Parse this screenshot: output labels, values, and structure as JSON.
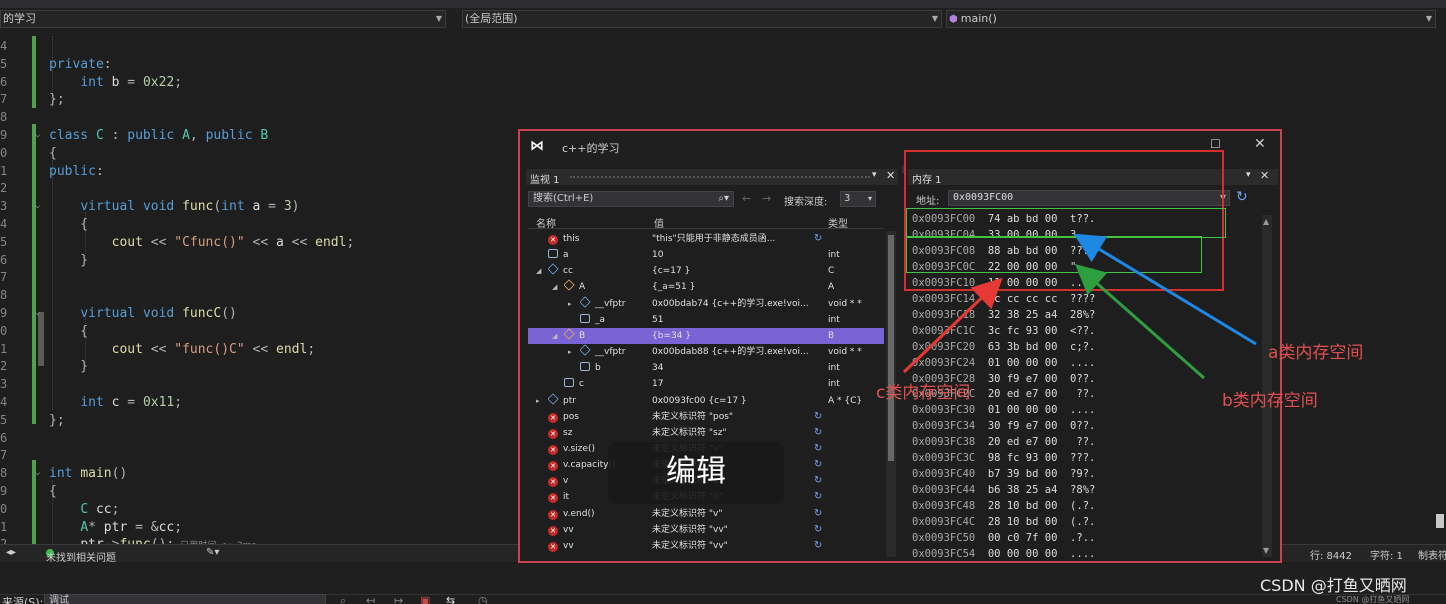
{
  "nav": {
    "project": "的学习",
    "scope": "(全局范围)",
    "member": "main()"
  },
  "code": {
    "lines": [
      {
        "n": "4",
        "t": ""
      },
      {
        "n": "5",
        "t": "private:"
      },
      {
        "n": "6",
        "t": "    int b = 0x22;"
      },
      {
        "n": "7",
        "t": "};"
      },
      {
        "n": "8",
        "t": ""
      },
      {
        "n": "9",
        "t": "class C : public A, public B"
      },
      {
        "n": "0",
        "t": "{"
      },
      {
        "n": "1",
        "t": "public:"
      },
      {
        "n": "2",
        "t": ""
      },
      {
        "n": "3",
        "t": "    virtual void func(int a = 3)"
      },
      {
        "n": "4",
        "t": "    {"
      },
      {
        "n": "5",
        "t": "        cout << \"Cfunc()\" << a << endl;"
      },
      {
        "n": "6",
        "t": "    }"
      },
      {
        "n": "7",
        "t": ""
      },
      {
        "n": "8",
        "t": ""
      },
      {
        "n": "9",
        "t": "    virtual void funcC()"
      },
      {
        "n": "0",
        "t": "    {"
      },
      {
        "n": "1",
        "t": "        cout << \"func()C\" << endl;"
      },
      {
        "n": "2",
        "t": "    }"
      },
      {
        "n": "3",
        "t": ""
      },
      {
        "n": "4",
        "t": "    int c = 0x11;"
      },
      {
        "n": "5",
        "t": "};"
      },
      {
        "n": "6",
        "t": ""
      },
      {
        "n": "7",
        "t": ""
      },
      {
        "n": "8",
        "t": "int main()"
      },
      {
        "n": "9",
        "t": "{"
      },
      {
        "n": "0",
        "t": "    C cc;"
      },
      {
        "n": "1",
        "t": "    A* ptr = &cc;"
      },
      {
        "n": "2",
        "t": "    ptr->func();"
      }
    ],
    "timing": "已用时间 <= 2ms"
  },
  "status": {
    "issues": "未找到相关问题",
    "line": "行: 8442",
    "char": "字符: 1",
    "mode": "制表符"
  },
  "bottom": {
    "source_label": "来源(S):",
    "source_value": "调试",
    "watermark": "CSDN @打鱼又晒网",
    "watermark2": "CSDN @打鱼又晒网"
  },
  "debug_window": {
    "title": "c++的学习",
    "watch": {
      "tab": "监视 1",
      "search_placeholder": "搜索(Ctrl+E)",
      "depth_label": "搜索深度:",
      "depth_value": "3",
      "headers": {
        "name": "名称",
        "value": "值",
        "type": "类型"
      },
      "rows": [
        {
          "name": "this",
          "value": "\"this\"只能用于非静态成员函...",
          "type": "",
          "icon": "error"
        },
        {
          "name": "a",
          "value": "10",
          "type": "int",
          "icon": "field"
        },
        {
          "name": "cc",
          "value": "{c=17 }",
          "type": "C",
          "icon": "cube"
        },
        {
          "name": "A",
          "value": "{_a=51 }",
          "type": "A",
          "icon": "base"
        },
        {
          "name": "__vfptr",
          "value": "0x00bdab74 {c++的学习.exe!voi...",
          "type": "void * *",
          "icon": "cube"
        },
        {
          "name": "_a",
          "value": "51",
          "type": "int",
          "icon": "field"
        },
        {
          "name": "B",
          "value": "{b=34 }",
          "type": "B",
          "icon": "base"
        },
        {
          "name": "__vfptr",
          "value": "0x00bdab88 {c++的学习.exe!voi...",
          "type": "void * *",
          "icon": "cube"
        },
        {
          "name": "b",
          "value": "34",
          "type": "int",
          "icon": "field"
        },
        {
          "name": "c",
          "value": "17",
          "type": "int",
          "icon": "field"
        },
        {
          "name": "ptr",
          "value": "0x0093fc00 {c=17 }",
          "type": "A * {C}",
          "icon": "cube"
        },
        {
          "name": "pos",
          "value": "未定义标识符 \"pos\"",
          "type": "",
          "icon": "error"
        },
        {
          "name": "sz",
          "value": "未定义标识符 \"sz\"",
          "type": "",
          "icon": "error"
        },
        {
          "name": "v.size()",
          "value": "未定义标识符 \"v\"",
          "type": "",
          "icon": "error"
        },
        {
          "name": "v.capacity()",
          "value": "未定义标识符 \"v\"",
          "type": "",
          "icon": "error"
        },
        {
          "name": "v",
          "value": "未定义标识符 \"v\"",
          "type": "",
          "icon": "error"
        },
        {
          "name": "it",
          "value": "未定义标识符 \"it\"",
          "type": "",
          "icon": "error"
        },
        {
          "name": "v.end()",
          "value": "未定义标识符 \"v\"",
          "type": "",
          "icon": "error"
        },
        {
          "name": "vv",
          "value": "未定义标识符 \"vv\"",
          "type": "",
          "icon": "error"
        },
        {
          "name": "vv",
          "value": "未定义标识符 \"vv\"",
          "type": "",
          "icon": "error"
        }
      ]
    },
    "memory": {
      "tab": "内存 1",
      "address_label": "地址:",
      "address_value": "0x0093FC00",
      "lines": [
        {
          "addr": "0x0093FC00",
          "bytes": "74 ab bd 00",
          "chars": "t??."
        },
        {
          "addr": "0x0093FC04",
          "bytes": "33 00 00 00",
          "chars": "3..."
        },
        {
          "addr": "0x0093FC08",
          "bytes": "88 ab bd 00",
          "chars": "???."
        },
        {
          "addr": "0x0093FC0C",
          "bytes": "22 00 00 00",
          "chars": "\"..."
        },
        {
          "addr": "0x0093FC10",
          "bytes": "11 00 00 00",
          "chars": "...."
        },
        {
          "addr": "0x0093FC14",
          "bytes": "cc cc cc cc",
          "chars": "????"
        },
        {
          "addr": "0x0093FC18",
          "bytes": "32 38 25 a4",
          "chars": "28%?"
        },
        {
          "addr": "0x0093FC1C",
          "bytes": "3c fc 93 00",
          "chars": "<??."
        },
        {
          "addr": "0x0093FC20",
          "bytes": "63 3b bd 00",
          "chars": "c;?."
        },
        {
          "addr": "0x0093FC24",
          "bytes": "01 00 00 00",
          "chars": "...."
        },
        {
          "addr": "0x0093FC28",
          "bytes": "30 f9 e7 00",
          "chars": "0??."
        },
        {
          "addr": "0x0093FC2C",
          "bytes": "20 ed e7 00",
          "chars": " ??."
        },
        {
          "addr": "0x0093FC30",
          "bytes": "01 00 00 00",
          "chars": "...."
        },
        {
          "addr": "0x0093FC34",
          "bytes": "30 f9 e7 00",
          "chars": "0??."
        },
        {
          "addr": "0x0093FC38",
          "bytes": "20 ed e7 00",
          "chars": " ??."
        },
        {
          "addr": "0x0093FC3C",
          "bytes": "98 fc 93 00",
          "chars": "???."
        },
        {
          "addr": "0x0093FC40",
          "bytes": "b7 39 bd 00",
          "chars": "?9?."
        },
        {
          "addr": "0x0093FC44",
          "bytes": "b6 38 25 a4",
          "chars": "?8%?"
        },
        {
          "addr": "0x0093FC48",
          "bytes": "28 10 bd 00",
          "chars": "(.?."
        },
        {
          "addr": "0x0093FC4C",
          "bytes": "28 10 bd 00",
          "chars": "(.?."
        },
        {
          "addr": "0x0093FC50",
          "bytes": "00 c0 7f 00",
          "chars": ".?.."
        },
        {
          "addr": "0x0093FC54",
          "bytes": "00 00 00 00",
          "chars": "...."
        }
      ]
    }
  },
  "annotations": {
    "a_label": "a类内存空间",
    "b_label": "b类内存空间",
    "c_label": "c类内存空间",
    "edit_overlay": "编辑"
  },
  "colors": {
    "a_arrow": "#1e88e5",
    "b_arrow": "#2e9e3e",
    "c_arrow": "#e53935",
    "highlight_row": "#7a63d4",
    "window_border": "#c94450"
  }
}
